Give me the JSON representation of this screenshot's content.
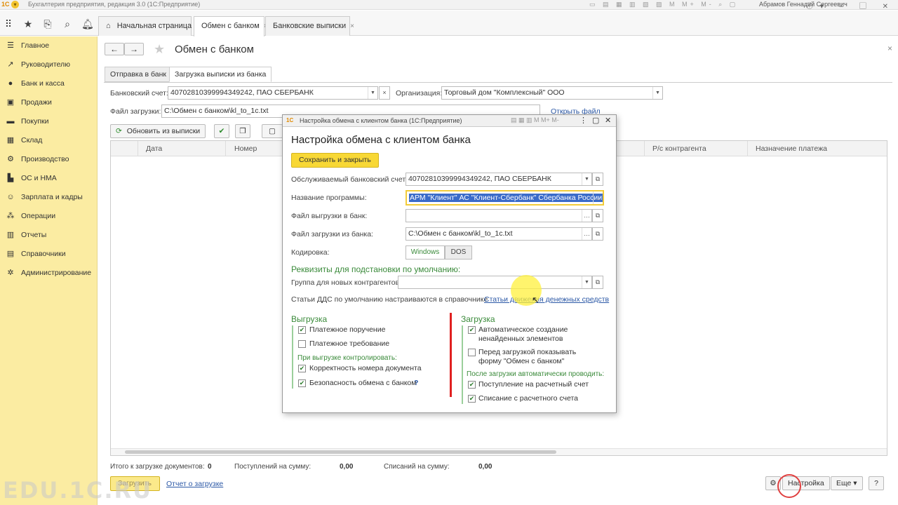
{
  "titlebar": {
    "app_title": "Бухгалтерия предприятия, редакция 3.0  (1С:Предприятие)",
    "user": "Абрамов Геннадий Сергеевич"
  },
  "tabs": [
    {
      "label": "Начальная страница"
    },
    {
      "label": "Обмен с банком",
      "close": "×"
    },
    {
      "label": "Банковские выписки",
      "close": "×"
    }
  ],
  "sidebar": {
    "items": [
      {
        "label": "Главное",
        "icon": "menu-icon"
      },
      {
        "label": "Руководителю",
        "icon": "chart-line-icon"
      },
      {
        "label": "Банк и касса",
        "icon": "ruble-icon"
      },
      {
        "label": "Продажи",
        "icon": "cart-icon"
      },
      {
        "label": "Покупки",
        "icon": "truck-icon"
      },
      {
        "label": "Склад",
        "icon": "warehouse-icon"
      },
      {
        "label": "Производство",
        "icon": "gear-icon"
      },
      {
        "label": "ОС и НМА",
        "icon": "building-icon"
      },
      {
        "label": "Зарплата и кадры",
        "icon": "person-icon"
      },
      {
        "label": "Операции",
        "icon": "operations-icon"
      },
      {
        "label": "Отчеты",
        "icon": "bar-chart-icon"
      },
      {
        "label": "Справочники",
        "icon": "book-icon"
      },
      {
        "label": "Администрирование",
        "icon": "settings-icon"
      }
    ]
  },
  "page": {
    "title": "Обмен с банком",
    "subtabs": [
      "Отправка в банк",
      "Загрузка выписки из банка"
    ],
    "bank_account_label": "Банковский счет:",
    "bank_account_value": "40702810399994349242, ПАО СБЕРБАНК",
    "org_label": "Организация:",
    "org_value": "Торговый дом \"Комплексный\" ООО",
    "file_label": "Файл загрузки:",
    "file_value": "C:\\Обмен с банком\\kl_to_1c.txt",
    "open_file": "Открыть файл",
    "refresh_btn": "Обновить из выписки",
    "grid_columns": [
      "Дата",
      "Номер",
      "Р/с контрагента",
      "Назначение платежа"
    ],
    "footer": {
      "total_label": "Итого к загрузке документов:",
      "total_value": "0",
      "income_label": "Поступлений на сумму:",
      "income_value": "0,00",
      "outcome_label": "Списаний на сумму:",
      "outcome_value": "0,00"
    },
    "load_btn": "Загрузить",
    "report_link": "Отчет о загрузке",
    "settings_btn": "Настройка",
    "more_btn": "Еще",
    "help_btn": "?"
  },
  "dialog": {
    "window_title": "Настройка обмена с клиентом банка  (1С:Предприятие)",
    "heading": "Настройка обмена с клиентом банка",
    "save_close": "Сохранить и закрыть",
    "served_account_label": "Обслуживаемый банковский счет:",
    "served_account_value": "40702810399994349242, ПАО СБЕРБАНК",
    "program_label": "Название программы:",
    "program_value": "АРМ \"Клиент\" АС \"Клиент-Сбербанк\" Сбербанка России",
    "export_file_label": "Файл выгрузки в банк:",
    "export_file_value": "",
    "import_file_label": "Файл загрузки из банка:",
    "import_file_value": "C:\\Обмен с банком\\kl_to_1c.txt",
    "encoding_label": "Кодировка:",
    "encoding_options": [
      "Windows",
      "DOS"
    ],
    "defaults_heading": "Реквизиты для подстановки по умолчанию:",
    "group_label": "Группа для новых контрагентов:",
    "group_value": "",
    "dds_text": "Статьи ДДС по умолчанию настраиваются в справочнике",
    "dds_link": "Статьи движения денежных средств",
    "export_heading": "Выгрузка",
    "export_items": [
      {
        "label": "Платежное поручение",
        "checked": true
      },
      {
        "label": "Платежное требование",
        "checked": false
      }
    ],
    "export_control_heading": "При выгрузке контролировать:",
    "export_control_items": [
      {
        "label": "Корректность номера документа",
        "checked": true
      },
      {
        "label": "Безопасность обмена с банком",
        "checked": true
      }
    ],
    "help_q": "?",
    "import_heading": "Загрузка",
    "import_items": [
      {
        "label1": "Автоматическое создание",
        "label2": "ненайденных элементов",
        "checked": true
      },
      {
        "label1": "Перед загрузкой показывать",
        "label2": "форму \"Обмен с банком\"",
        "checked": false
      }
    ],
    "import_auto_heading": "После загрузки автоматически проводить:",
    "import_auto_items": [
      {
        "label": "Поступление на расчетный счет",
        "checked": true
      },
      {
        "label": "Списание с расчетного счета",
        "checked": true
      }
    ]
  },
  "watermark": "EDU.1C.RU",
  "colors": {
    "sidebar_bg": "#fbeca2",
    "accent_yellow": "#f8d835",
    "green_heading": "#3a8a3a",
    "link_blue": "#2b58a6",
    "selection_blue": "#3a6bc9",
    "annotation_red": "#e02020"
  }
}
